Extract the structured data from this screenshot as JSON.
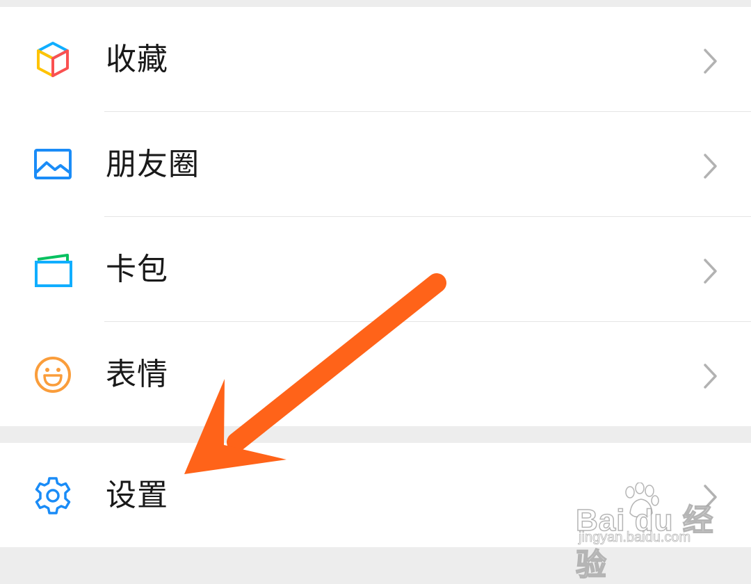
{
  "menu": {
    "items": [
      {
        "label": "收藏",
        "icon": "favorites-cube-icon"
      },
      {
        "label": "朋友圈",
        "icon": "moments-picture-icon"
      },
      {
        "label": "卡包",
        "icon": "card-wallet-icon"
      },
      {
        "label": "表情",
        "icon": "smiley-icon"
      }
    ],
    "settings": {
      "label": "设置",
      "icon": "gear-icon"
    }
  },
  "annotation": {
    "type": "arrow",
    "color": "#ff6319",
    "points_to": "设置"
  },
  "watermark": {
    "brand": "Bai du 经验",
    "url": "jingyan.baidu.com"
  },
  "colors": {
    "background": "#ededed",
    "row_background": "#ffffff",
    "text": "#191919",
    "chevron": "#b2b2b2",
    "icon_blue": "#1a8cf7",
    "icon_orange": "#fa9d3b",
    "arrow": "#ff6319"
  }
}
